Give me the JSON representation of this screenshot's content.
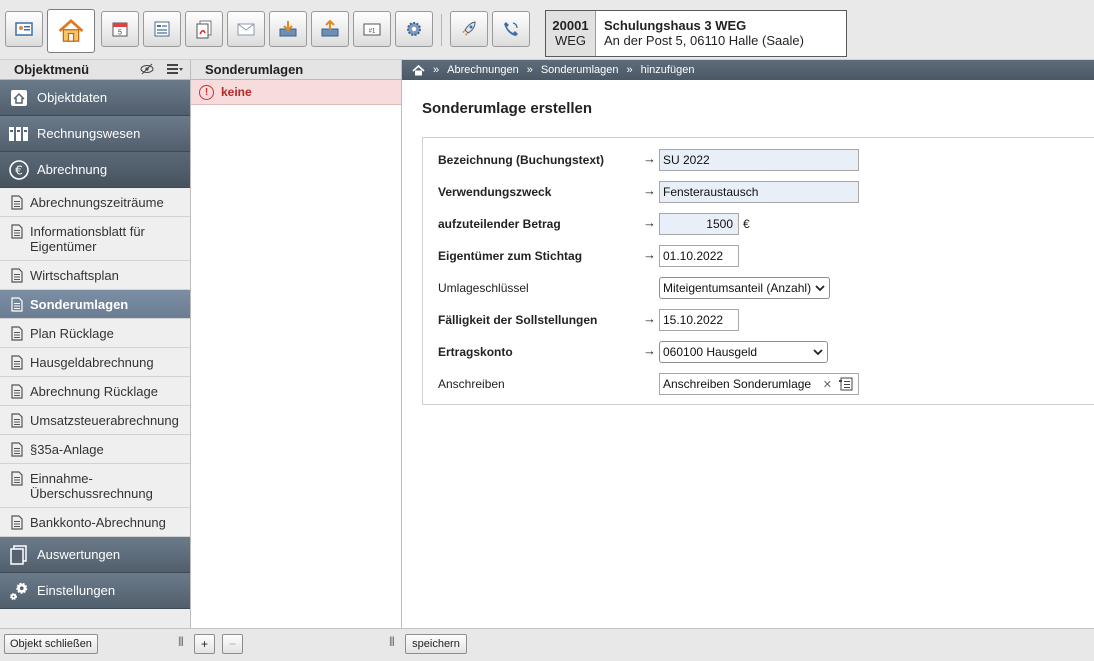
{
  "toolbar": {
    "buttons": [
      {
        "name": "contact-card-icon",
        "active": false
      },
      {
        "name": "home-icon",
        "active": true
      },
      {
        "name": "calendar-icon",
        "active": false
      },
      {
        "name": "form-icon",
        "active": false
      },
      {
        "name": "pdf-icon",
        "active": false
      },
      {
        "name": "mail-icon",
        "active": false
      },
      {
        "name": "inbox-download-icon",
        "active": false
      },
      {
        "name": "inbox-upload-icon",
        "active": false
      },
      {
        "name": "ticket-number-icon",
        "active": false
      },
      {
        "name": "gear-icon",
        "active": false
      },
      {
        "name": "rocket-icon",
        "active": false
      },
      {
        "name": "phone-icon",
        "active": false
      }
    ],
    "object": {
      "number": "20001",
      "type": "WEG",
      "name": "Schulungshaus 3 WEG",
      "address": "An der Post 5, 06110 Halle (Saale)"
    }
  },
  "sidebar": {
    "title": "Objektmenü",
    "categories": [
      {
        "label": "Objektdaten",
        "icon": "house-doc-icon"
      },
      {
        "label": "Rechnungswesen",
        "icon": "binders-icon"
      },
      {
        "label": "Abrechnung",
        "icon": "euro-icon"
      }
    ],
    "items": [
      {
        "label": "Abrechnungszeiträume",
        "active": false
      },
      {
        "label": "Informationsblatt für Eigentümer",
        "active": false
      },
      {
        "label": "Wirtschaftsplan",
        "active": false
      },
      {
        "label": "Sonderumlagen",
        "active": true
      },
      {
        "label": "Plan Rücklage",
        "active": false
      },
      {
        "label": "Hausgeldabrechnung",
        "active": false
      },
      {
        "label": "Abrechnung Rücklage",
        "active": false
      },
      {
        "label": "Umsatzsteuerabrechnung",
        "active": false
      },
      {
        "label": "§35a-Anlage",
        "active": false
      },
      {
        "label": "Einnahme-Überschussrechnung",
        "active": false
      },
      {
        "label": "Bankkonto-Abrechnung",
        "active": false
      }
    ],
    "bottom_categories": [
      {
        "label": "Auswertungen",
        "icon": "documents-icon"
      },
      {
        "label": "Einstellungen",
        "icon": "gears-icon"
      }
    ],
    "close_label": "Objekt schließen"
  },
  "middle": {
    "title": "Sonderumlagen",
    "empty_label": "keine",
    "add_label": "+",
    "remove_label": "−"
  },
  "breadcrumb": {
    "items": [
      "Abrechnungen",
      "Sonderumlagen",
      "hinzufügen"
    ]
  },
  "form": {
    "title": "Sonderumlage erstellen",
    "fields": {
      "bezeichnung": {
        "label": "Bezeichnung (Buchungstext)",
        "value": "SU 2022"
      },
      "verwendungszweck": {
        "label": "Verwendungszweck",
        "value": "Fensteraustausch"
      },
      "betrag": {
        "label": "aufzuteilender Betrag",
        "value": "1500",
        "unit": "€"
      },
      "stichtag": {
        "label": "Eigentümer zum Stichtag",
        "value": "01.10.2022"
      },
      "umlageschluessel": {
        "label": "Umlageschlüssel",
        "value": "Miteigentumsanteil (Anzahl)"
      },
      "faelligkeit": {
        "label": "Fälligkeit der Sollstellungen",
        "value": "15.10.2022"
      },
      "ertragskonto": {
        "label": "Ertragskonto",
        "value": "060100 Hausgeld"
      },
      "anschreiben": {
        "label": "Anschreiben",
        "value": "Anschreiben Sonderumlage"
      }
    },
    "arrow": "→",
    "save_label": "speichern"
  },
  "colors": {
    "category_bg": "#5b6876",
    "active_item_bg": "#7c8ea3",
    "empty_bg": "#f6dcdc",
    "empty_text": "#b82525"
  }
}
